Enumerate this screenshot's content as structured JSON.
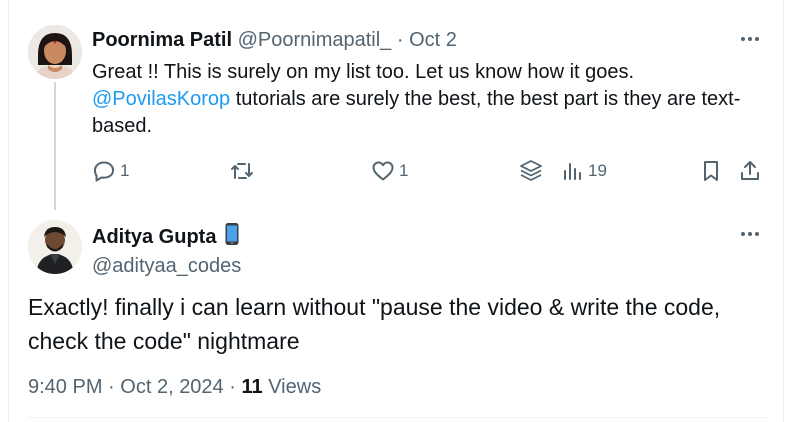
{
  "reply_tweet": {
    "author_name": "Poornima Patil",
    "author_handle": "@Poornimapatil_",
    "separator": "·",
    "date": "Oct 2",
    "text_before": "Great !! This is surely on my list too. Let us know how it goes.",
    "mention": "@PovilasKorop",
    "text_after": " tutorials are surely the best, the best part is they are text-based.",
    "actions": {
      "reply_count": "1",
      "retweet_count": "",
      "like_count": "1",
      "views_count": "19"
    }
  },
  "main_tweet": {
    "author_name": "Aditya Gupta",
    "author_handle": "@adityaa_codes",
    "text": "Exactly! finally i can learn without \"pause the video & write the code, check the code\" nightmare",
    "time": "9:40 PM",
    "separator": "·",
    "date": "Oct 2, 2024",
    "views_count": "11",
    "views_label": "Views"
  },
  "icons": {
    "reply": "reply-icon",
    "retweet": "retweet-icon",
    "like": "heart-icon",
    "grok": "stack-icon",
    "views": "analytics-icon",
    "bookmark": "bookmark-icon",
    "share": "share-icon",
    "more": "more-icon",
    "badge": "phone-emoji-icon"
  },
  "colors": {
    "text": "#0f1419",
    "muted": "#536471",
    "link": "#1d9bf0",
    "thread_line": "#cfd9de"
  }
}
